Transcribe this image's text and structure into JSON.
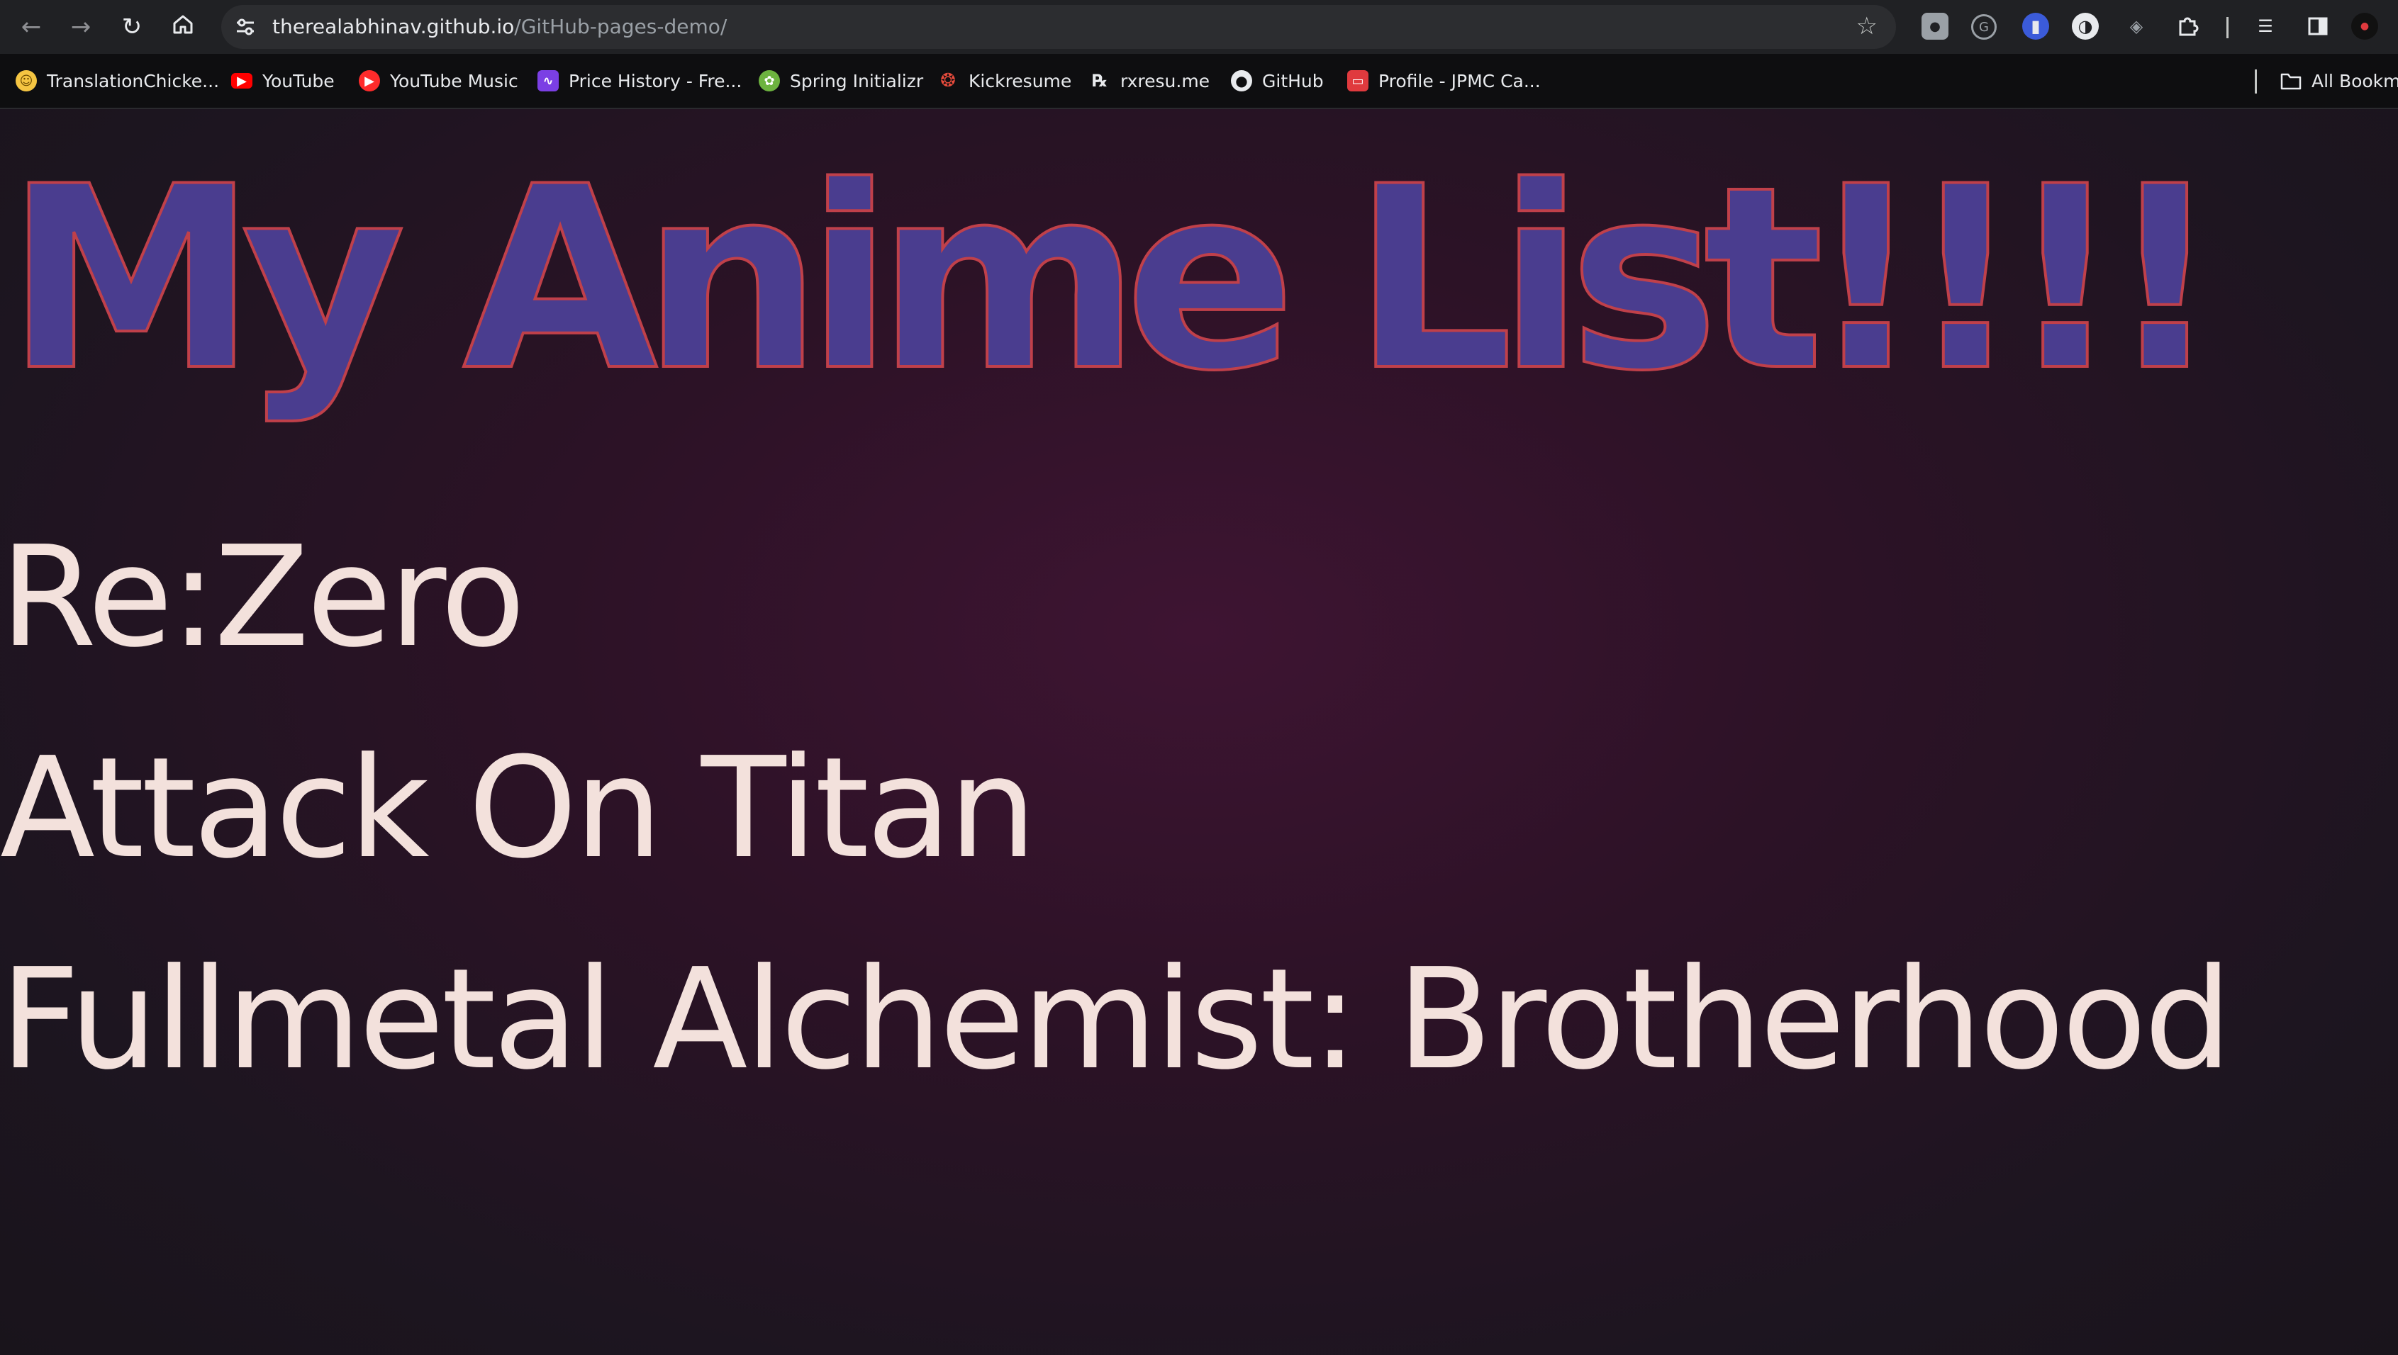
{
  "browser": {
    "nav": {
      "back_icon": "arrow-left-icon",
      "forward_icon": "arrow-right-icon",
      "reload_icon": "reload-icon",
      "home_icon": "home-icon"
    },
    "omnibox": {
      "site_info_icon": "tune-icon",
      "url_host": "therealabhinav.github.io",
      "url_path": "/GitHub-pages-demo/",
      "bookmark_icon": "star-icon"
    },
    "bookmarks": [
      {
        "label": "TranslationChicke...",
        "icon": "translation-chicken-icon",
        "color": "#f5c542"
      },
      {
        "label": "YouTube",
        "icon": "youtube-icon",
        "color": "#ff0000"
      },
      {
        "label": "YouTube Music",
        "icon": "youtube-music-icon",
        "color": "#ff2b2b"
      },
      {
        "label": "Price History - Fre...",
        "icon": "price-history-icon",
        "color": "#7b3fe4"
      },
      {
        "label": "Spring Initializr",
        "icon": "spring-icon",
        "color": "#6db33f"
      },
      {
        "label": "Kickresume",
        "icon": "kickresume-icon",
        "color": "#e84b3c"
      },
      {
        "label": "rxresu.me",
        "icon": "rx-icon",
        "color": "#e8eaed"
      },
      {
        "label": "GitHub",
        "icon": "github-icon",
        "color": "#e8eaed"
      },
      {
        "label": "Profile - JPMC Ca...",
        "icon": "profile-icon",
        "color": "#e03a3e"
      }
    ],
    "all_bookmarks_label": "All Bookma"
  },
  "page": {
    "title": "My Anime List!!!!",
    "anime": [
      "Re:Zero",
      "Attack On Titan",
      "Fullmetal Alchemist: Brotherhood"
    ]
  },
  "colors": {
    "title_fill": "#4a3d8f",
    "title_stroke": "#c0404a",
    "list_text": "#f3e1dc",
    "background_center": "#3e1432",
    "background_edge": "#19141b"
  }
}
